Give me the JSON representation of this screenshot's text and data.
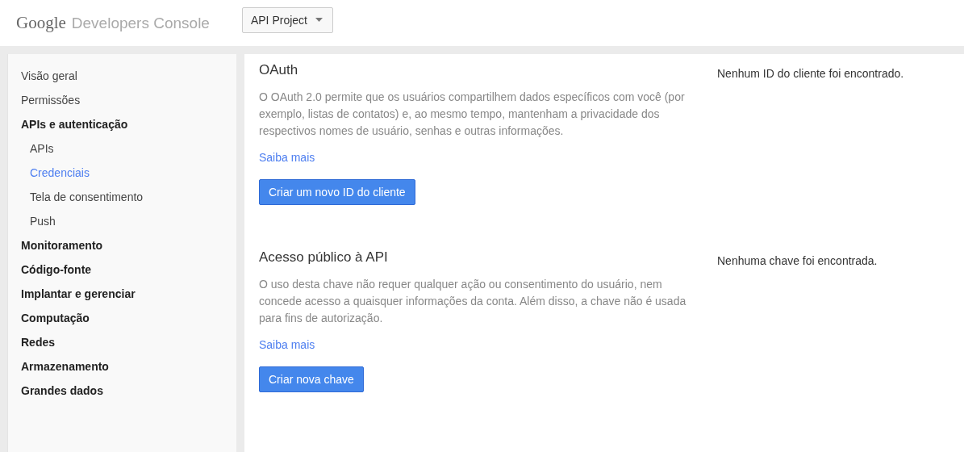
{
  "header": {
    "logo": {
      "brand": "Google",
      "product": "Developers Console"
    },
    "project_selector": {
      "value": "API Project"
    }
  },
  "sidebar": {
    "items": [
      {
        "label": "Visão geral",
        "kind": "link",
        "selected": false
      },
      {
        "label": "Permissões",
        "kind": "link",
        "selected": false
      },
      {
        "label": "APIs e autenticação",
        "kind": "group",
        "selected": false,
        "children": [
          {
            "label": "APIs",
            "selected": false
          },
          {
            "label": "Credenciais",
            "selected": true
          },
          {
            "label": "Tela de consentimento",
            "selected": false
          },
          {
            "label": "Push",
            "selected": false
          }
        ]
      },
      {
        "label": "Monitoramento",
        "kind": "group",
        "selected": false
      },
      {
        "label": "Código-fonte",
        "kind": "group",
        "selected": false
      },
      {
        "label": "Implantar e gerenciar",
        "kind": "group",
        "selected": false
      },
      {
        "label": "Computação",
        "kind": "group",
        "selected": false
      },
      {
        "label": "Redes",
        "kind": "group",
        "selected": false
      },
      {
        "label": "Armazenamento",
        "kind": "group",
        "selected": false
      },
      {
        "label": "Grandes dados",
        "kind": "group",
        "selected": false
      }
    ]
  },
  "sections": [
    {
      "title": "OAuth",
      "description": "O OAuth 2.0 permite que os usuários compartilhem dados específicos com você (por exemplo, listas de contatos) e, ao mesmo tempo, mantenham a privacidade dos respectivos nomes de usuário, senhas e outras informações.",
      "link": "Saiba mais",
      "button": "Criar um novo ID do cliente",
      "status": "Nenhum ID do cliente foi encontrado."
    },
    {
      "title": "Acesso público à API",
      "description": "O uso desta chave não requer qualquer ação ou consentimento do usuário, nem concede acesso a quaisquer informações da conta. Além disso, a chave não é usada para fins de autorização.",
      "link": "Saiba mais",
      "button": "Criar nova chave",
      "status": "Nenhuma chave foi encontrada."
    }
  ]
}
